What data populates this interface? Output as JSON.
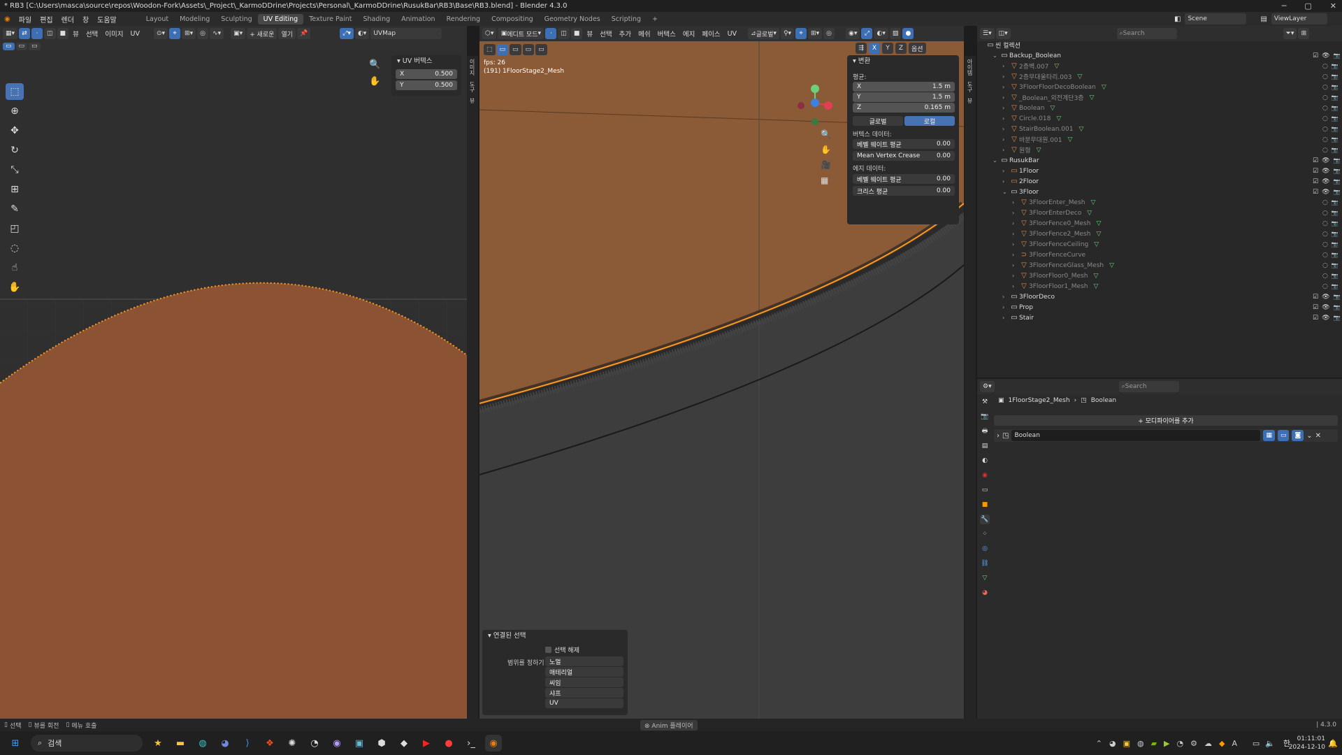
{
  "window": {
    "title": "* RB3 [C:\\Users\\masca\\source\\repos\\Woodon-Fork\\Assets\\_Project\\_KarmoDDrine\\Projects\\Personal\\_KarmoDDrine\\RusukBar\\RB3\\Base\\RB3.blend] - Blender 4.3.0",
    "minimize": "─",
    "maximize": "▢",
    "close": "✕"
  },
  "menu": [
    "파일",
    "편집",
    "렌더",
    "창",
    "도움말"
  ],
  "workspaces": [
    "Layout",
    "Modeling",
    "Sculpting",
    "UV Editing",
    "Texture Paint",
    "Shading",
    "Animation",
    "Rendering",
    "Compositing",
    "Geometry Nodes",
    "Scripting",
    "+"
  ],
  "active_workspace": "UV Editing",
  "scene": "Scene",
  "view_layer": "ViewLayer",
  "uv_editor": {
    "header": [
      "뷰",
      "선택",
      "이미지",
      "UV"
    ],
    "new_btn": "+ 새로운",
    "open_btn": "열기",
    "uvmap": "UVMap",
    "panel_title": "UV 버텍스",
    "x_label": "X",
    "x_value": "0.500",
    "y_label": "Y",
    "y_value": "0.500",
    "side_tabs": [
      "이미지",
      "도구",
      "뷰"
    ]
  },
  "viewport": {
    "mode": "에디트 모드",
    "header": [
      "뷰",
      "선택",
      "추가",
      "메쉬",
      "버텍스",
      "에지",
      "페이스",
      "UV"
    ],
    "transform_orient": "글로벌",
    "options": "옵션",
    "axes": [
      "X",
      "Y",
      "Z"
    ],
    "fps": "fps: 26",
    "object_info": "(191) 1FloorStage2_Mesh",
    "transform_panel": {
      "title": "변환",
      "median": "평균:",
      "x_label": "X",
      "x": "1.5 m",
      "y_label": "Y",
      "y": "1.5 m",
      "z_label": "Z",
      "z": "0.165 m",
      "global": "글로벌",
      "local": "로컬",
      "vertex_data": "버텍스 데이터:",
      "bevel_weight": "베벨 웨이트 평균",
      "bevel_weight_v": "0.00",
      "crease": "Mean Vertex Crease",
      "crease_v": "0.00",
      "edge_data": "에지 데이터:",
      "edge_bevel": "베벨 웨이트 평균",
      "edge_bevel_v": "0.00",
      "edge_crease": "크리스 평균",
      "edge_crease_v": "0.00"
    },
    "side_tabs": [
      "아이템",
      "도구",
      "뷰"
    ],
    "linked_panel": {
      "title": "연결된 선택",
      "deselect": "선택 해제",
      "delimit": "범위를 정하기",
      "options": [
        "노멀",
        "매테리얼",
        "씨임",
        "샤프",
        "UV"
      ]
    }
  },
  "outliner": {
    "search": "Search",
    "root": "씬 컬렉션",
    "items": [
      {
        "name": "Backup_Boolean",
        "depth": 1,
        "type": "coll"
      },
      {
        "name": "2층벽.007",
        "depth": 2,
        "type": "mesh"
      },
      {
        "name": "2층무대울타리.003",
        "depth": 2,
        "type": "mesh"
      },
      {
        "name": "3FloorFloorDecoBoolean",
        "depth": 2,
        "type": "mesh"
      },
      {
        "name": "_Boolean_외전계단3층",
        "depth": 2,
        "type": "mesh"
      },
      {
        "name": "Boolean",
        "depth": 2,
        "type": "mesh"
      },
      {
        "name": "Circle.018",
        "depth": 2,
        "type": "mesh"
      },
      {
        "name": "StairBoolean.001",
        "depth": 2,
        "type": "mesh"
      },
      {
        "name": "바분무대원.001",
        "depth": 2,
        "type": "mesh"
      },
      {
        "name": "원형",
        "depth": 2,
        "type": "mesh"
      },
      {
        "name": "RusukBar",
        "depth": 1,
        "type": "coll"
      },
      {
        "name": "1Floor",
        "depth": 2,
        "type": "coll-red"
      },
      {
        "name": "2Floor",
        "depth": 2,
        "type": "coll-red"
      },
      {
        "name": "3Floor",
        "depth": 2,
        "type": "coll"
      },
      {
        "name": "3FloorEnter_Mesh",
        "depth": 3,
        "type": "mesh"
      },
      {
        "name": "3FloorEnterDeco",
        "depth": 3,
        "type": "mesh"
      },
      {
        "name": "3FloorFence0_Mesh",
        "depth": 3,
        "type": "mesh"
      },
      {
        "name": "3FloorFence2_Mesh",
        "depth": 3,
        "type": "mesh"
      },
      {
        "name": "3FloorFenceCeiling",
        "depth": 3,
        "type": "mesh"
      },
      {
        "name": "3FloorFenceCurve",
        "depth": 3,
        "type": "curve"
      },
      {
        "name": "3FloorFenceGlass_Mesh",
        "depth": 3,
        "type": "mesh"
      },
      {
        "name": "3FloorFloor0_Mesh",
        "depth": 3,
        "type": "mesh"
      },
      {
        "name": "3FloorFloor1_Mesh",
        "depth": 3,
        "type": "mesh"
      },
      {
        "name": "3FloorDeco",
        "depth": 2,
        "type": "coll"
      },
      {
        "name": "Prop",
        "depth": 2,
        "type": "coll"
      },
      {
        "name": "Stair",
        "depth": 2,
        "type": "coll"
      }
    ]
  },
  "properties": {
    "search": "Search",
    "breadcrumb_obj": "1FloorStage2_Mesh",
    "breadcrumb_mod": "Boolean",
    "add_modifier": "+ 모디파이어를 추가",
    "modifier_name": "Boolean"
  },
  "status": {
    "select": "선택",
    "rotate": "뷰를 회전",
    "menu": "메뉴 호출",
    "anim_player": "Anim 플레이어",
    "version": "4.3.0"
  },
  "taskbar": {
    "search": "검색",
    "time": "01:11:01",
    "date": "2024-12-10",
    "lang": "한",
    "ime": "A"
  },
  "colors": {
    "accent": "#4772b3",
    "mesh_face": "#8b5234",
    "selected_edge": "#ff9a1f"
  }
}
